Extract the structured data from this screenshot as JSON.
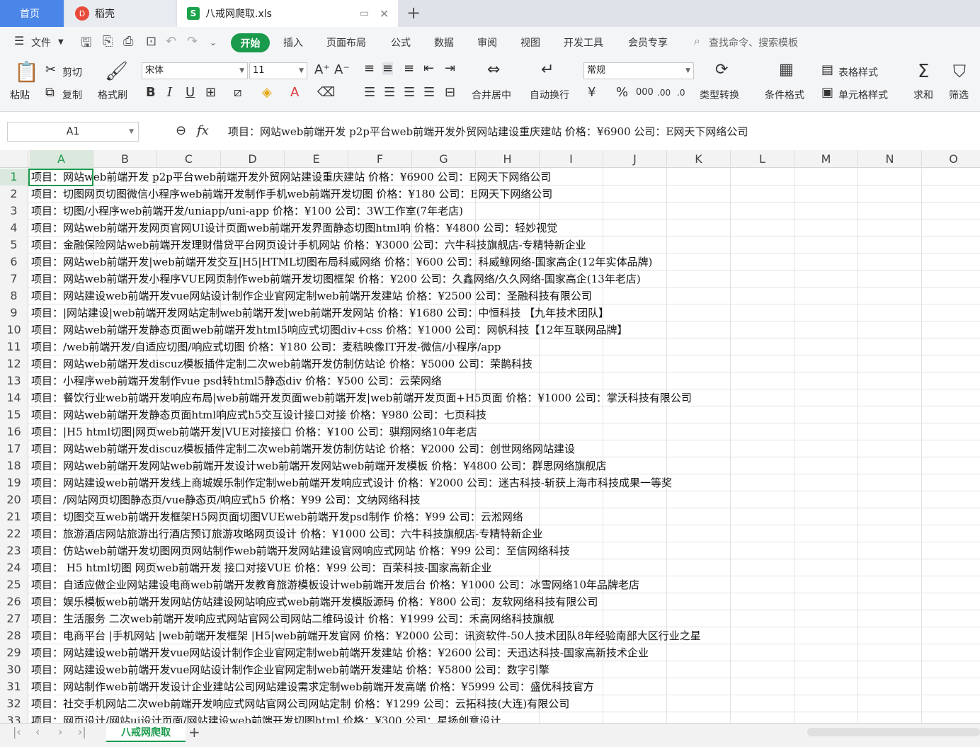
{
  "tabs": {
    "home": "首页",
    "daoke": "稻壳",
    "file": "八戒网爬取.xls",
    "daoke_logo": "D",
    "file_logo": "S"
  },
  "menu": {
    "file": "文件",
    "start": "开始",
    "items": [
      "插入",
      "页面布局",
      "公式",
      "数据",
      "审阅",
      "视图",
      "开发工具",
      "会员专享"
    ],
    "search": "查找命令、搜索模板"
  },
  "ribbon": {
    "paste": "粘贴",
    "cut": "剪切",
    "copy": "复制",
    "format_painter": "格式刷",
    "font": "宋体",
    "size": "11",
    "merge": "合并居中",
    "wrap": "自动换行",
    "number_format": "常规",
    "type_convert": "类型转换",
    "cond_format": "条件格式",
    "table_style": "表格样式",
    "cell_style": "单元格样式",
    "sum": "求和",
    "filter": "筛选"
  },
  "formula_bar": {
    "name_box": "A1",
    "fx": "fx",
    "value": "项目：网站web前端开发 p2p平台web前端开发外贸网站建设重庆建站  价格：¥6900   公司：E网天下网络公司"
  },
  "columns": [
    "A",
    "B",
    "C",
    "D",
    "E",
    "F",
    "G",
    "H",
    "I",
    "J",
    "K",
    "L",
    "M",
    "N",
    "O"
  ],
  "rows": [
    {
      "n": "1",
      "text": "项目：网站web前端开发 p2p平台web前端开发外贸网站建设重庆建站  价格：¥6900   公司：E网天下网络公司"
    },
    {
      "n": "2",
      "text": "项目：切图网页切图微信小程序web前端开发制作手机web前端开发切图  价格：¥180   公司：E网天下网络公司"
    },
    {
      "n": "3",
      "text": "项目：切图/小程序web前端开发/uniapp/uni-app  价格：¥100   公司：3W工作室(7年老店)"
    },
    {
      "n": "4",
      "text": "项目：网站web前端开发网页官网UI设计页面web前端开发界面静态切图html响  价格：¥4800   公司：轻妙视觉"
    },
    {
      "n": "5",
      "text": "项目：金融保险网站web前端开发理财借贷平台网页设计手机网站  价格：¥3000   公司：六牛科技旗舰店-专精特新企业"
    },
    {
      "n": "6",
      "text": "项目：网站web前端开发|web前端开发交互|H5|HTML切图布局科威网络  价格：¥600   公司：科威鲸网络-国家高企(12年实体品牌)"
    },
    {
      "n": "7",
      "text": "项目：网站web前端开发小程序VUE网页制作web前端开发切图框架  价格：¥200   公司：久鑫网络/久久网络-国家高企(13年老店)"
    },
    {
      "n": "8",
      "text": "项目：网站建设web前端开发vue网站设计制作企业官网定制web前端开发建站  价格：¥2500   公司：圣融科技有限公司"
    },
    {
      "n": "9",
      "text": "项目：|网站建设|web前端开发网站定制web前端开发|web前端开发网站  价格：¥1680   公司：中恒科技 【九年技术团队】"
    },
    {
      "n": "10",
      "text": "项目：网站web前端开发静态页面web前端开发html5响应式切图div+css  价格：¥1000   公司：网帆科技【12年互联网品牌】"
    },
    {
      "n": "11",
      "text": "项目：/web前端开发/自适应切图/响应式切图  价格：¥180   公司：麦秸映像IT开发-微信/小程序/app"
    },
    {
      "n": "12",
      "text": "项目：网站web前端开发discuz模板插件定制二次web前端开发仿制仿站论  价格：¥5000   公司：荣鹊科技"
    },
    {
      "n": "13",
      "text": "项目：小程序web前端开发制作vue psd转html5静态div  价格：¥500   公司：云荣网络"
    },
    {
      "n": "14",
      "text": "项目：餐饮行业web前端开发响应布局|web前端开发页面web前端开发|web前端开发页面+H5页面  价格：¥1000   公司：掌沃科技有限公司"
    },
    {
      "n": "15",
      "text": "项目：网站web前端开发静态页面html响应式h5交互设计接口对接  价格：¥980   公司：七页科技"
    },
    {
      "n": "16",
      "text": "项目：|H5 html切图|网页web前端开发|VUE对接接口  价格：¥100   公司：骐翔网络10年老店"
    },
    {
      "n": "17",
      "text": "项目：网站web前端开发discuz模板插件定制二次web前端开发仿制仿站论  价格：¥2000   公司：创世网络网站建设"
    },
    {
      "n": "18",
      "text": "项目：网站web前端开发网站web前端开发设计web前端开发网站web前端开发模板  价格：¥4800   公司：群思网络旗舰店"
    },
    {
      "n": "19",
      "text": "项目：网站建设web前端开发线上商城娱乐制作定制web前端开发响应式设计  价格：¥2000   公司：迷古科技-斩获上海市科技成果一等奖"
    },
    {
      "n": "20",
      "text": "项目：/网站网页切图静态页/vue静态页/响应式h5  价格：¥99   公司：文纳网络科技"
    },
    {
      "n": "21",
      "text": "项目：切图交互web前端开发框架H5网页面切图VUEweb前端开发psd制作  价格：¥99   公司：云淞网络"
    },
    {
      "n": "22",
      "text": "项目：旅游酒店网站旅游出行酒店预订旅游攻略网页设计  价格：¥1000   公司：六牛科技旗舰店-专精特新企业"
    },
    {
      "n": "23",
      "text": "项目：仿站web前端开发切图网页网站制作web前端开发网站建设官网响应式网站  价格：¥99   公司：至信网络科技"
    },
    {
      "n": "24",
      "text": "项目： H5 html切图 网页web前端开发 接口对接VUE  价格：¥99   公司：百荣科技-国家高新企业"
    },
    {
      "n": "25",
      "text": "项目：自适应做企业网站建设电商web前端开发教育旅游模板设计web前端开发后台  价格：¥1000   公司：冰雪网络10年品牌老店"
    },
    {
      "n": "26",
      "text": "项目：娱乐模板web前端开发网站仿站建设网站响应式web前端开发模版源码  价格：¥800   公司：友软网络科技有限公司"
    },
    {
      "n": "27",
      "text": "项目：生活服务 二次web前端开发响应式网站官网公司网站二维码设计  价格：¥1999   公司：禾高网络科技旗舰"
    },
    {
      "n": "28",
      "text": "项目：电商平台 |手机网站 |web前端开发框架 |H5|web前端开发官网  价格：¥2000   公司：讯资软件-50人技术团队8年经验南部大区行业之星"
    },
    {
      "n": "29",
      "text": "项目：网站建设web前端开发vue网站设计制作企业官网定制web前端开发建站  价格：¥2600   公司：天迅达科技-国家高新技术企业"
    },
    {
      "n": "30",
      "text": "项目：网站建设web前端开发vue网站设计制作企业官网定制web前端开发建站  价格：¥5800   公司：数字引擎"
    },
    {
      "n": "31",
      "text": "项目：网站制作web前端开发设计企业建站公司网站建设需求定制web前端开发高端  价格：¥5999   公司：盛优科技官方"
    },
    {
      "n": "32",
      "text": "项目：社交手机网站二次web前端开发响应式网站官网公司网站定制  价格：¥1299   公司：云拓科技(大连)有限公司"
    },
    {
      "n": "33",
      "text": "项目：网页设计/网站ui设计页面/网站建设web前端开发切图html  价格：¥300   公司：星扬创意设计"
    }
  ],
  "sheet": {
    "name": "八戒网爬取"
  }
}
